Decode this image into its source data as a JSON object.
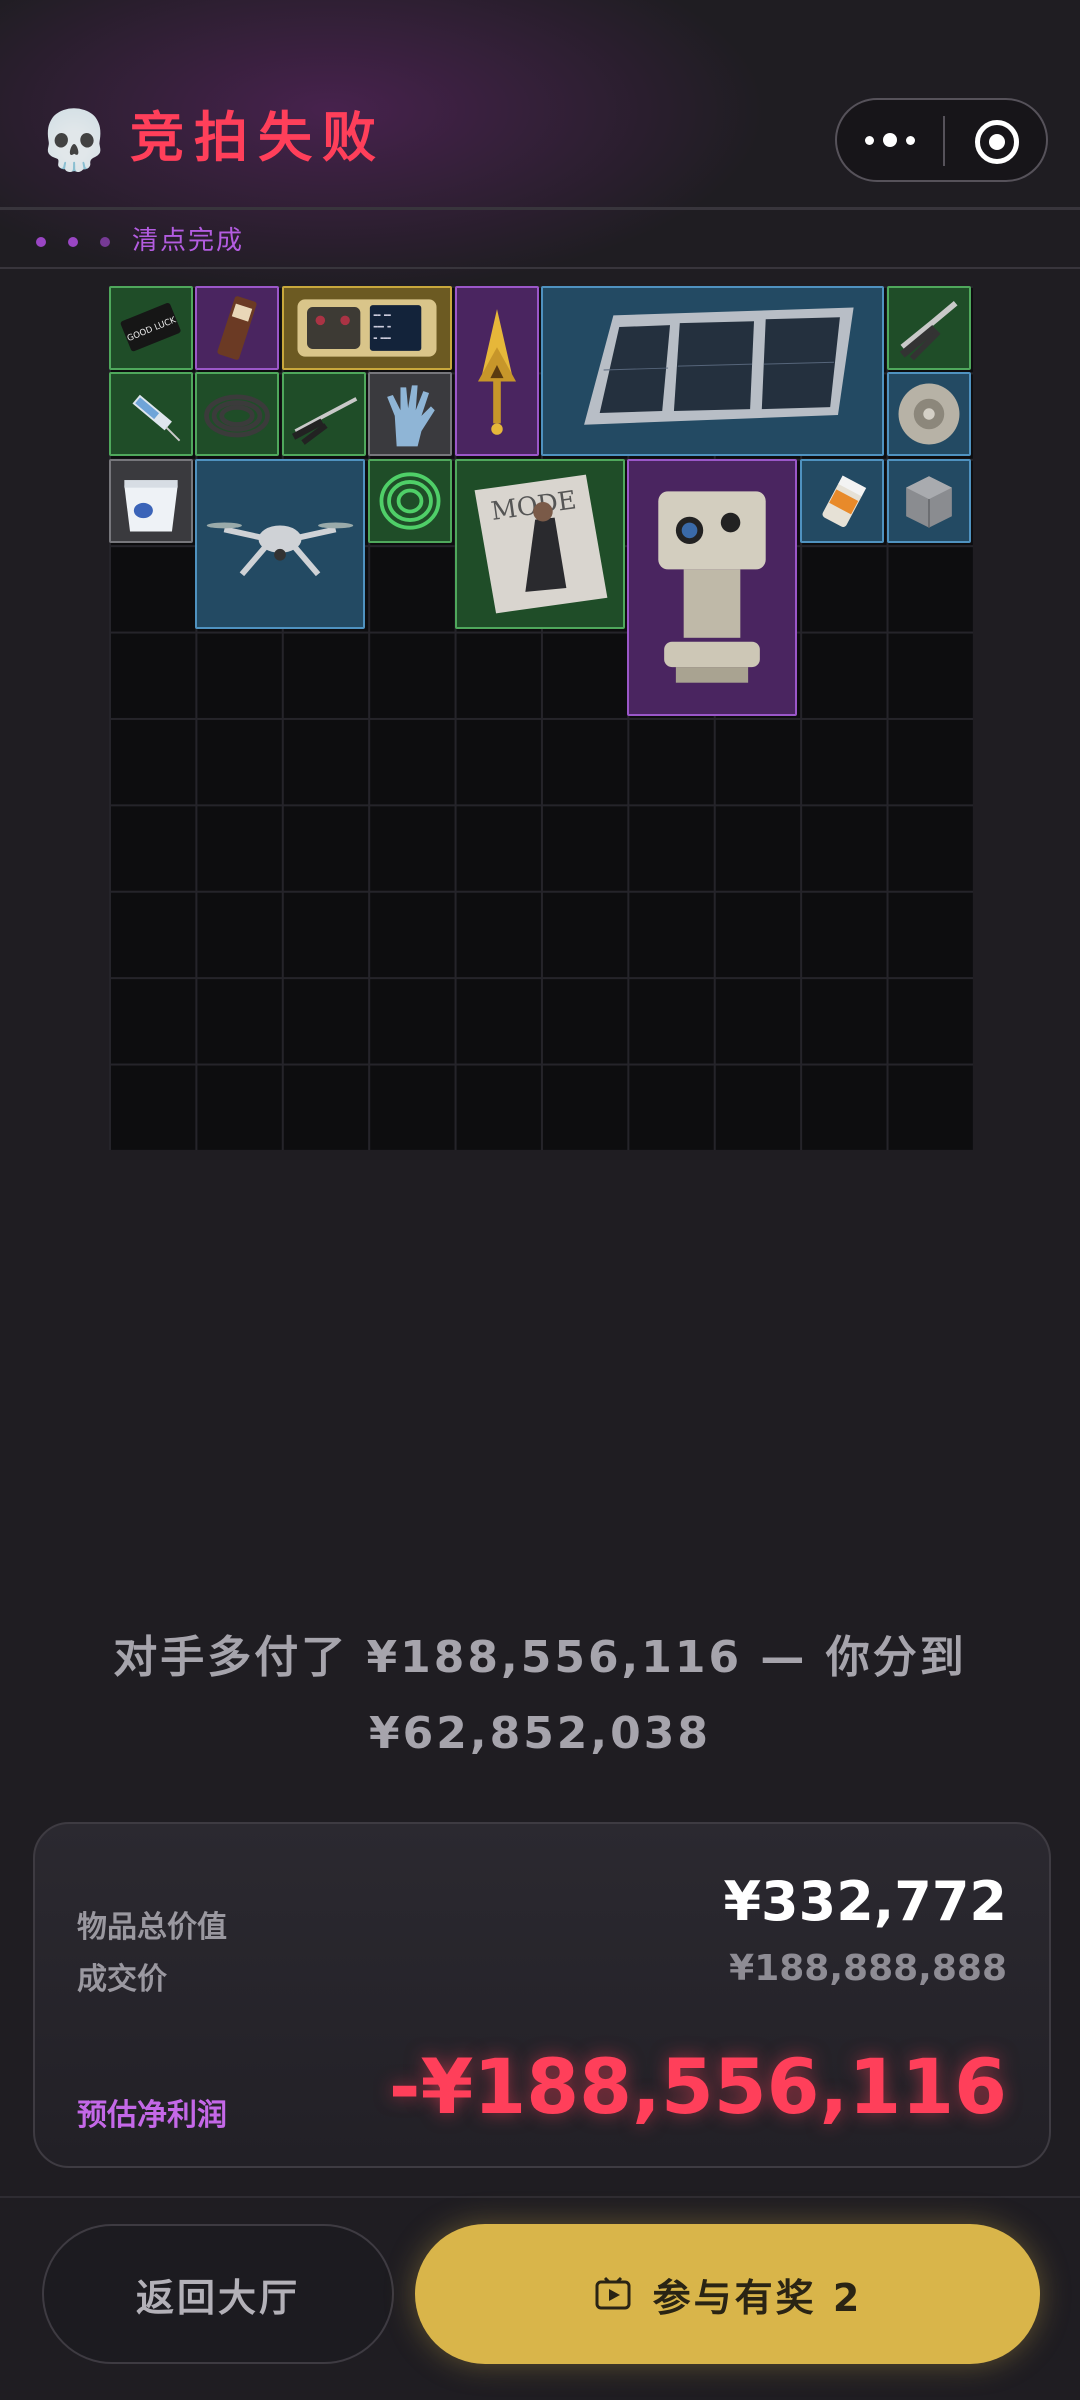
{
  "header": {
    "icon": "skull-icon",
    "title": "竞拍失败",
    "capsule_icons": [
      "more-dots-icon",
      "close-target-icon"
    ]
  },
  "status": {
    "label": "清点完成"
  },
  "inventory": {
    "columns": 10,
    "rows": 10,
    "items": [
      {
        "name": "good-luck-card",
        "rarity": "green"
      },
      {
        "name": "chocolate-bar",
        "rarity": "purple"
      },
      {
        "name": "gold-dive-computer",
        "rarity": "gold"
      },
      {
        "name": "golden-trophy",
        "rarity": "purple"
      },
      {
        "name": "solar-panel",
        "rarity": "blue"
      },
      {
        "name": "pliers",
        "rarity": "green"
      },
      {
        "name": "syringe",
        "rarity": "green"
      },
      {
        "name": "hose-coil",
        "rarity": "green"
      },
      {
        "name": "needle-nose-pliers",
        "rarity": "green"
      },
      {
        "name": "rubber-glove",
        "rarity": "white"
      },
      {
        "name": "hard-disk",
        "rarity": "blue"
      },
      {
        "name": "yogurt-cup",
        "rarity": "white"
      },
      {
        "name": "drone",
        "rarity": "blue"
      },
      {
        "name": "green-wire-spool",
        "rarity": "green"
      },
      {
        "name": "mode-magazine",
        "rarity": "green"
      },
      {
        "name": "thermal-camera",
        "rarity": "purple"
      },
      {
        "name": "pill-bottle",
        "rarity": "blue"
      },
      {
        "name": "metal-box",
        "rarity": "blue"
      }
    ],
    "magazine_text": "MODE",
    "card_text": "GOOD LUCK"
  },
  "summary": {
    "line1": "对手多付了 ¥188,556,116 — 你分到",
    "line2": "¥62,852,038"
  },
  "card": {
    "total_value_label": "物品总价值",
    "total_value": "¥332,772",
    "deal_price_label": "成交价",
    "deal_price": "¥188,888,888",
    "net_profit_label": "预估净利润",
    "net_profit": "-¥188,556,116"
  },
  "buttons": {
    "back_label": "返回大厅",
    "join_label": "参与有奖 2",
    "join_icon": "tv-icon"
  },
  "colors": {
    "accent_red": "#ff3f5a",
    "accent_purple": "#b35ce0",
    "button_gold": "#d9b54a",
    "background": "#1f1d22"
  }
}
